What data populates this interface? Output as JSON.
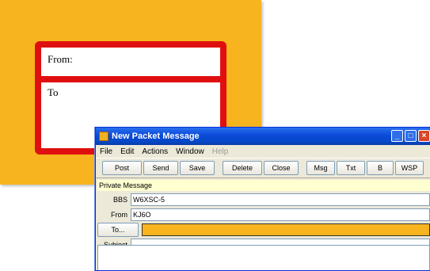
{
  "label": {
    "from_text": "From:",
    "to_text": "To"
  },
  "window": {
    "title": "New Packet Message",
    "buttons": {
      "minimize": "_",
      "maximize": "□",
      "close": "×"
    }
  },
  "menu": {
    "items": [
      "File",
      "Edit",
      "Actions",
      "Window",
      "Help"
    ]
  },
  "toolbar": {
    "buttons": [
      "Post",
      "Send",
      "Save",
      "Delete",
      "Close",
      "Msg",
      "Txt",
      "B",
      "WSP"
    ]
  },
  "message_type": "Private Message",
  "fields": {
    "bbs_label": "BBS",
    "bbs_value": "W6XSC-5",
    "from_label": "From",
    "from_value": "KJ6O",
    "to_button": "To...",
    "to_value": "",
    "subject_label": "Subject",
    "subject_value": ""
  }
}
